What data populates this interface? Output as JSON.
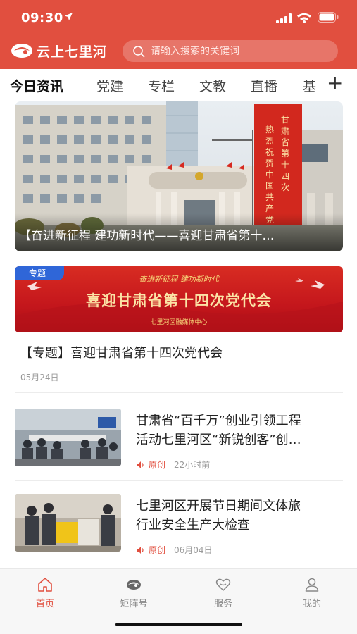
{
  "colors": {
    "accent": "#e14f3f",
    "tab_active": "#111111",
    "nav_active": "#e14f3f",
    "badge": "#2f66d8"
  },
  "status_bar": {
    "time": "09:30",
    "icons": [
      "location-arrow-icon",
      "signal-icon",
      "wifi-icon",
      "battery-icon"
    ]
  },
  "header": {
    "app_name": "云上七里河",
    "logo_icon": "cloud-bird-logo",
    "search": {
      "placeholder": "请输入搜索的关键词",
      "icon": "search-icon"
    }
  },
  "tabs": {
    "items": [
      {
        "label": "今日资讯",
        "active": true
      },
      {
        "label": "党建",
        "active": false
      },
      {
        "label": "专栏",
        "active": false
      },
      {
        "label": "文教",
        "active": false
      },
      {
        "label": "直播",
        "active": false
      },
      {
        "label": "基",
        "active": false
      }
    ],
    "more_label": "+"
  },
  "hero": {
    "caption": "【奋进新征程 建功新时代——喜迎甘肃省第十…"
  },
  "feature": {
    "badge": "专题",
    "banner_tagline": "奋进新征程 建功新时代",
    "banner_headline": "喜迎甘肃省第十四次党代会",
    "banner_org": "七里河区融媒体中心",
    "title": "【专题】喜迎甘肃省第十四次党代会",
    "date": "05月24日"
  },
  "news": [
    {
      "title_line1": "甘肃省“百千万”创业引领工程",
      "title_line2": "活动七里河区“新锐创客”创…",
      "source": "原创",
      "time": "22小时前"
    },
    {
      "title_line1": "七里河区开展节日期间文体旅",
      "title_line2": "行业安全生产大检查",
      "source": "原创",
      "time": "06月04日"
    }
  ],
  "bottom_nav": [
    {
      "label": "首页",
      "icon": "home-icon",
      "active": true
    },
    {
      "label": "矩阵号",
      "icon": "matrix-logo-icon",
      "active": false
    },
    {
      "label": "服务",
      "icon": "service-heart-icon",
      "active": false
    },
    {
      "label": "我的",
      "icon": "person-icon",
      "active": false
    }
  ]
}
